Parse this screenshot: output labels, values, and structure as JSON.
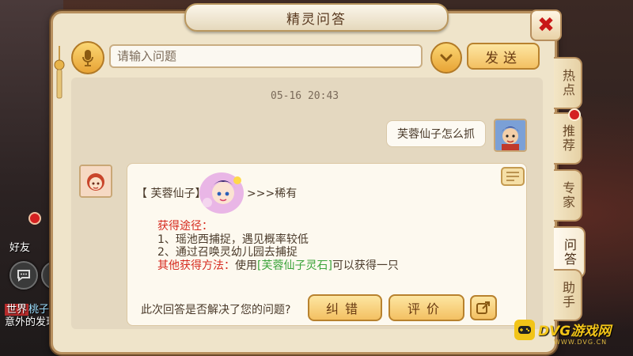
{
  "window": {
    "title": "精灵问答"
  },
  "header": {
    "search_placeholder": "请输入问题",
    "send_label": "发送"
  },
  "chat": {
    "timestamp": "05-16 20:43",
    "user_message": "芙蓉仙子怎么抓",
    "answer": {
      "name_prefix": "【 芙蓉仙子】",
      "rarity": ">>>稀有",
      "obtain_label": "获得途径：",
      "line1": "1、瑶池西捕捉，遇见概率较低",
      "line2": "2、通过召唤灵幼儿园去捕捉",
      "other_label": "其他获得方法：",
      "other_pre": "使用",
      "other_item": "[芙蓉仙子灵石]",
      "other_post": "可以获得一只"
    },
    "feedback_question": "此次回答是否解决了您的问题?",
    "correct_label": "纠错",
    "rate_label": "评价"
  },
  "tabs": [
    {
      "label": "热点"
    },
    {
      "label": "推荐"
    },
    {
      "label": "专家"
    },
    {
      "label": "问答"
    },
    {
      "label": "助手"
    }
  ],
  "game_background": {
    "friends_label": "好友",
    "chat_line1_tag": "世界",
    "chat_line1_name": "桃子：",
    "chat_line2": "意外的发现"
  },
  "watermark": {
    "brand": "DVG游戏网",
    "url": "WWW.DVG.CN"
  },
  "colors": {
    "panel_bg": "#efe4ca",
    "accent_gold": "#f3c062",
    "red_text": "#d62b1f",
    "green_text": "#3aa33a"
  },
  "icons": [
    "microphone-icon",
    "chevron-down-icon",
    "close-icon",
    "share-icon",
    "scroll-icon"
  ]
}
